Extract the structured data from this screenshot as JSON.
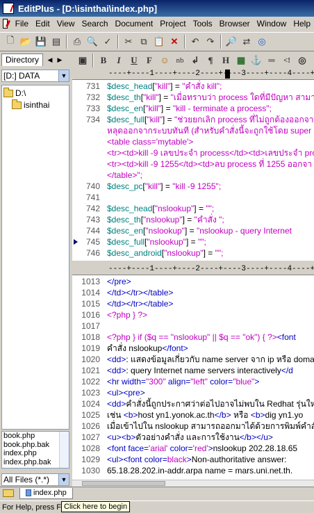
{
  "window": {
    "title": "EditPlus - [D:\\isinthai\\index.php]"
  },
  "menu": [
    "File",
    "Edit",
    "View",
    "Search",
    "Document",
    "Project",
    "Tools",
    "Browser",
    "Window",
    "Help"
  ],
  "toolbar_icons": [
    "new-file",
    "open-file",
    "save",
    "save-all",
    "print",
    "print-preview",
    "spellcheck",
    "cut",
    "copy",
    "paste",
    "delete",
    "undo",
    "redo",
    "find",
    "replace",
    "browser"
  ],
  "format_toolbar": [
    {
      "name": "bold",
      "glyph": "B"
    },
    {
      "name": "italic",
      "glyph": "I"
    },
    {
      "name": "underline",
      "glyph": "U"
    },
    {
      "name": "font",
      "glyph": "F"
    },
    {
      "name": "color",
      "glyph": "☺"
    },
    {
      "name": "nbsp",
      "glyph": "nb"
    },
    {
      "name": "br",
      "glyph": "↲"
    },
    {
      "name": "paragraph",
      "glyph": "¶"
    },
    {
      "name": "heading",
      "glyph": "H"
    },
    {
      "name": "image",
      "glyph": "▦"
    },
    {
      "name": "anchor",
      "glyph": "⚓"
    },
    {
      "name": "hr",
      "glyph": "═"
    },
    {
      "name": "comment",
      "glyph": "<!"
    },
    {
      "name": "table",
      "glyph": "◎"
    }
  ],
  "left_panel": {
    "tab_label": "Directory",
    "drive": "[D:] DATA",
    "tree": [
      {
        "label": "D:\\",
        "level": 0
      },
      {
        "label": "isinthai",
        "level": 1
      }
    ],
    "files": [
      "book.php",
      "book.php.bak",
      "index.php",
      "index.php.bak"
    ],
    "filter": "All Files (*.*)"
  },
  "ruler": "----+----1----+----2----+----3----+----4----+----5",
  "top_pane": [
    {
      "num": "731",
      "parts": [
        [
          "c-var",
          "$desc_head"
        ],
        [
          "c-op",
          "["
        ],
        [
          "c-str",
          "\"kill\""
        ],
        [
          "c-op",
          "] = "
        ],
        [
          "c-str",
          "\"คำสั่ง kill\";"
        ]
      ]
    },
    {
      "num": "732",
      "parts": [
        [
          "c-var",
          "$desc_th"
        ],
        [
          "c-op",
          "["
        ],
        [
          "c-str",
          "\"kill\""
        ],
        [
          "c-op",
          "] = "
        ],
        [
          "c-str",
          "\"เมื่อทราบว่า process ใดที่มีปัญหา สามา"
        ]
      ]
    },
    {
      "num": "733",
      "parts": [
        [
          "c-var",
          "$desc_en"
        ],
        [
          "c-op",
          "["
        ],
        [
          "c-str",
          "\"kill\""
        ],
        [
          "c-op",
          "] = "
        ],
        [
          "c-str",
          "\"kill - terminate a process\";"
        ]
      ]
    },
    {
      "num": "734",
      "parts": [
        [
          "c-var",
          "$desc_full"
        ],
        [
          "c-op",
          "["
        ],
        [
          "c-str",
          "\"kill\""
        ],
        [
          "c-op",
          "] = "
        ],
        [
          "c-str",
          "\"ช่วยยกเลิก process ที่ไม่ถูกต้องออกจาก"
        ]
      ]
    },
    {
      "num": "",
      "parts": [
        [
          "c-str",
          "หลุดออกจากระบบทันที (สำหรับคำสั่งนี้จะถูกใช้โดย super user"
        ]
      ]
    },
    {
      "num": "",
      "parts": [
        [
          "c-str",
          "<table class='mytable'>"
        ]
      ]
    },
    {
      "num": "",
      "parts": [
        [
          "c-str",
          "<tr><td>kill -9 เลขประจำ process</td><td>เลขประจำ pro"
        ]
      ]
    },
    {
      "num": "",
      "parts": [
        [
          "c-str",
          "<tr><td>kill -9 1255</td><td>ลบ process ที่ 1255 ออกจา"
        ]
      ]
    },
    {
      "num": "",
      "parts": [
        [
          "c-str",
          "</table>\";"
        ]
      ]
    },
    {
      "num": "740",
      "parts": [
        [
          "c-var",
          "$desc_pc"
        ],
        [
          "c-op",
          "["
        ],
        [
          "c-str",
          "\"kill\""
        ],
        [
          "c-op",
          "] = "
        ],
        [
          "c-str",
          "\"kill -9 1255\";"
        ]
      ]
    },
    {
      "num": "741",
      "parts": []
    },
    {
      "num": "742",
      "parts": [
        [
          "c-var",
          "$desc_head"
        ],
        [
          "c-op",
          "["
        ],
        [
          "c-str",
          "\"nslookup\""
        ],
        [
          "c-op",
          "] = "
        ],
        [
          "c-str",
          "\"\";"
        ]
      ]
    },
    {
      "num": "743",
      "parts": [
        [
          "c-var",
          "$desc_th"
        ],
        [
          "c-op",
          "["
        ],
        [
          "c-str",
          "\"nslookup\""
        ],
        [
          "c-op",
          "] = "
        ],
        [
          "c-str",
          "\"คำสั่ง \";"
        ]
      ]
    },
    {
      "num": "744",
      "parts": [
        [
          "c-var",
          "$desc_en"
        ],
        [
          "c-op",
          "["
        ],
        [
          "c-str",
          "\"nslookup\""
        ],
        [
          "c-op",
          "] = "
        ],
        [
          "c-str",
          "\"nslookup - query Internet"
        ]
      ]
    },
    {
      "num": "745",
      "mark": true,
      "parts": [
        [
          "c-var",
          "$desc_full"
        ],
        [
          "c-op",
          "["
        ],
        [
          "c-str",
          "\"nslookup\""
        ],
        [
          "c-op",
          "] = "
        ],
        [
          "c-str",
          "\"\";"
        ]
      ]
    },
    {
      "num": "746",
      "parts": [
        [
          "c-var",
          "$desc_android"
        ],
        [
          "c-op",
          "["
        ],
        [
          "c-str",
          "\"nslookup\""
        ],
        [
          "c-op",
          "] = "
        ],
        [
          "c-str",
          "\"\";"
        ]
      ]
    }
  ],
  "bottom_pane": [
    {
      "num": "1013",
      "parts": [
        [
          "c-tag",
          "</pre>"
        ]
      ]
    },
    {
      "num": "1014",
      "parts": [
        [
          "c-tag",
          "</td></tr></table>"
        ]
      ]
    },
    {
      "num": "1015",
      "parts": [
        [
          "c-tag",
          "</td></tr></table>"
        ]
      ]
    },
    {
      "num": "1016",
      "parts": [
        [
          "c-str",
          "<?php } ?>"
        ]
      ]
    },
    {
      "num": "1017",
      "parts": []
    },
    {
      "num": "1018",
      "parts": [
        [
          "c-str",
          "<?php } if ($q == \"nslookup\" || $q == \"ok\") { ?>"
        ],
        [
          "c-tag",
          "<font"
        ]
      ]
    },
    {
      "num": "1019",
      "parts": [
        [
          "c-txt",
          "คำสั่ง nslookup"
        ],
        [
          "c-tag",
          "</font>"
        ]
      ]
    },
    {
      "num": "1020",
      "parts": [
        [
          "c-tag",
          "<dd>"
        ],
        [
          "c-txt",
          ": แสดงข้อมูลเกี่ยวกับ name server จาก ip หรือ domai"
        ]
      ]
    },
    {
      "num": "1021",
      "parts": [
        [
          "c-tag",
          "<dd>"
        ],
        [
          "c-txt",
          ": query Internet name servers interactively"
        ],
        [
          "c-tag",
          "</d"
        ]
      ]
    },
    {
      "num": "1022",
      "parts": [
        [
          "c-tag",
          "<hr width="
        ],
        [
          "c-str",
          "\"300\""
        ],
        [
          "c-tag",
          " align="
        ],
        [
          "c-str",
          "\"left\""
        ],
        [
          "c-tag",
          " color="
        ],
        [
          "c-str",
          "\"blue\""
        ],
        [
          "c-tag",
          ">"
        ]
      ]
    },
    {
      "num": "1023",
      "parts": [
        [
          "c-tag",
          "<ul><pre>"
        ]
      ]
    },
    {
      "num": "1024",
      "parts": [
        [
          "c-tag",
          "<dd>"
        ],
        [
          "c-txt",
          "คำสั่งนี้ถูกประกาศว่าต่อไปอาจไม่พบใน Redhat รุ่นใหม่ ถ้"
        ]
      ]
    },
    {
      "num": "1025",
      "parts": [
        [
          "c-txt",
          "เช่น "
        ],
        [
          "c-tag",
          "<b>"
        ],
        [
          "c-txt",
          "host yn1.yonok.ac.th"
        ],
        [
          "c-tag",
          "</b>"
        ],
        [
          "c-txt",
          " หรือ "
        ],
        [
          "c-tag",
          "<b>"
        ],
        [
          "c-txt",
          "dig yn1.yo"
        ]
      ]
    },
    {
      "num": "1026",
      "parts": [
        [
          "c-txt",
          "เมื่อเข้าไปใน nslookup สามารถออกมาได้ด้วยการพิมพ์คำสั่ง exi"
        ]
      ]
    },
    {
      "num": "1027",
      "parts": [
        [
          "c-tag",
          "<u><b>"
        ],
        [
          "c-txt",
          "ตัวอย่างคำสั่ง และการใช้งาน"
        ],
        [
          "c-tag",
          "</b></u>"
        ]
      ]
    },
    {
      "num": "1028",
      "parts": [
        [
          "c-tag",
          "<font face="
        ],
        [
          "c-str",
          "'arial'"
        ],
        [
          "c-tag",
          " color="
        ],
        [
          "c-str",
          "'red'"
        ],
        [
          "c-tag",
          ">"
        ],
        [
          "c-txt",
          "nslookup 202.28.18.65"
        ]
      ]
    },
    {
      "num": "1029",
      "parts": [
        [
          "c-tag",
          "<ul><font color="
        ],
        [
          "c-str",
          "black"
        ],
        [
          "c-tag",
          ">"
        ],
        [
          "c-txt",
          "Non-authoritative answer:"
        ]
      ]
    },
    {
      "num": "1030",
      "parts": [
        [
          "c-txt",
          "65.18.28.202.in-addr.arpa  name = mars.uni.net.th."
        ]
      ]
    }
  ],
  "file_tab": "index.php",
  "status": {
    "text": "For Help, press F1",
    "tooltip": "Click here to begin"
  }
}
